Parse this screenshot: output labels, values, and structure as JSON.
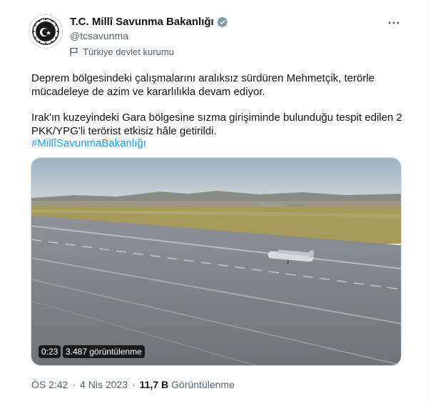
{
  "account": {
    "display_name": "T.C. Millî Savunma Bakanlığı",
    "handle": "@tcsavunma",
    "affiliation": "Türkiye devlet kurumu",
    "verified_color": "#829aab"
  },
  "tweet": {
    "paragraph1": "Deprem bölgesindeki çalışmalarını aralıksız sürdüren Mehmetçik, terörle mücadeleye de azim ve kararlılıkla devam ediyor.",
    "paragraph2": "Irak'ın kuzeyindeki Gara bölgesine sızma girişiminde bulunduğu tespit edilen 2 PKK/YPG'li  terörist etkisiz hâle getirildi.",
    "hashtag": "#MillîSavunmaBakanlığı"
  },
  "media": {
    "duration": "0:23",
    "views": "3.487 görüntülenme"
  },
  "meta": {
    "time": "ÖS 2:42",
    "date": "4 Nis 2023",
    "separator": "·",
    "view_count": "11,7 B",
    "view_label": "Görüntülenme"
  },
  "icons": {
    "more": "more-options-icon",
    "verified": "verified-badge-icon",
    "affiliation": "government-flag-icon",
    "avatar": "ministry-emblem-icon"
  },
  "colors": {
    "link": "#1d9bf0",
    "secondary_text": "#536471",
    "primary_text": "#0f1419"
  }
}
